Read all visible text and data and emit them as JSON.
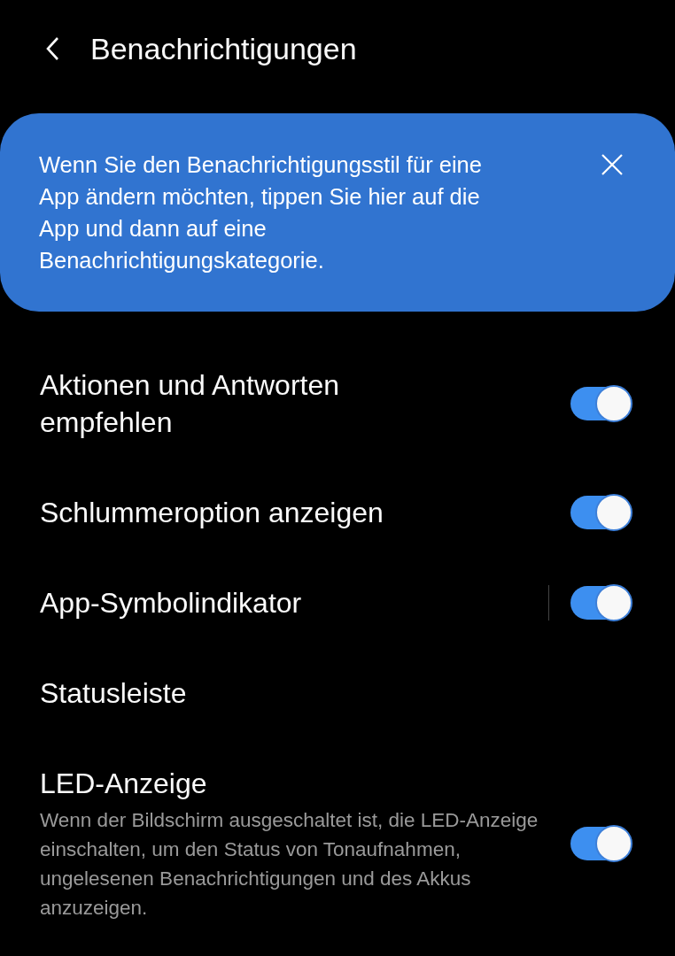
{
  "header": {
    "title": "Benachrichtigungen"
  },
  "banner": {
    "text": "Wenn Sie den Benachrichtigungsstil für eine App ändern möchten, tippen Sie hier auf die App und dann auf eine Benachrichtigungskategorie."
  },
  "settings": [
    {
      "kind": "switch",
      "title": "Aktionen und Antworten empfehlen",
      "on": true,
      "divider": false
    },
    {
      "kind": "switch",
      "title": "Schlummeroption anzeigen",
      "on": true,
      "divider": false
    },
    {
      "kind": "switch",
      "title": "App-Symbolindikator",
      "on": true,
      "divider": true
    },
    {
      "kind": "plain",
      "title": "Statusleiste"
    },
    {
      "kind": "switch",
      "title": "LED-Anzeige",
      "description": "Wenn der Bildschirm ausgeschaltet ist, die LED-Anzeige einschalten, um den Status von Tonaufnahmen, ungelesenen Benachrichtigungen und des Akkus anzuzeigen.",
      "on": true,
      "divider": false
    }
  ]
}
